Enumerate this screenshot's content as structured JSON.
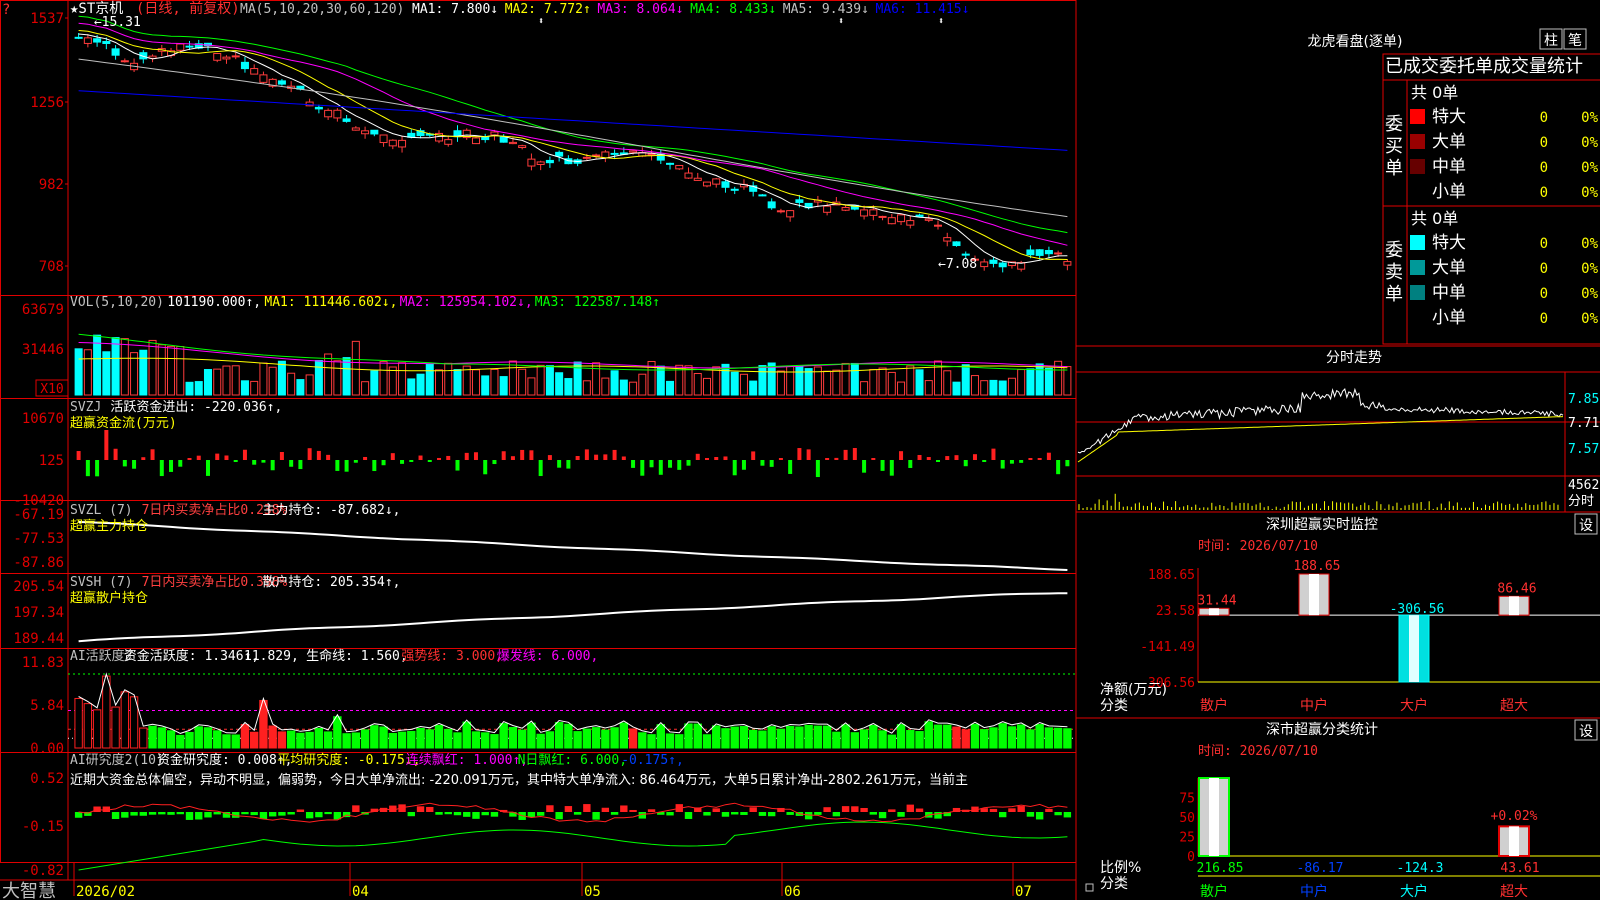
{
  "title_bar": {
    "stock_name": "★ST京机",
    "period": "(日线, 前复权)",
    "ma_label": "MA(5,10,20,30,60,120)",
    "ma_values": [
      {
        "label": "MA1: 7.800↓",
        "color": "#ffffff"
      },
      {
        "label": "MA2: 7.772↑",
        "color": "#ffff00"
      },
      {
        "label": "MA3: 8.064↓",
        "color": "#ff00ff"
      },
      {
        "label": "MA4: 8.433↓",
        "color": "#00ff00"
      },
      {
        "label": "MA5: 9.439↓",
        "color": "#c0c0c0"
      },
      {
        "label": "MA6: 11.415↓",
        "color": "#0000ff"
      }
    ]
  },
  "main_panel": {
    "y_ticks": [
      "1537",
      "1256",
      "982",
      "708"
    ],
    "high_label": "15.31",
    "low_label": "7.08"
  },
  "vol_panel": {
    "header": [
      {
        "text": "VOL(5,10,20)",
        "color": "#c0c0c0"
      },
      {
        "text": "101190.000↑,",
        "color": "#ffffff"
      },
      {
        "text": "MA1: 111446.602↓,",
        "color": "#ffff00"
      },
      {
        "text": "MA2: 125954.102↓,",
        "color": "#ff00ff"
      },
      {
        "text": "MA3: 122587.148↑",
        "color": "#00ff00"
      }
    ],
    "y_ticks": [
      "63679",
      "31446"
    ],
    "unit": "X10"
  },
  "svzj_panel": {
    "header": [
      {
        "text": "SVZJ",
        "color": "#c0c0c0"
      },
      {
        "text": "活跃资金进出: -220.036↑,",
        "color": "#ffffff"
      }
    ],
    "subtitle": "超赢资金流(万元)",
    "y_ticks": [
      "10670",
      "125",
      "-10420"
    ]
  },
  "svzl_panel": {
    "header": [
      {
        "text": "SVZL (7)",
        "color": "#c0c0c0"
      },
      {
        "text": "7日内买卖净占比0.238%",
        "color": "#ff4040"
      },
      {
        "text": "主力持仓: -87.682↓,",
        "color": "#ffffff"
      }
    ],
    "subtitle": "超赢主力持仓",
    "y_ticks": [
      "-67.19",
      "-77.53",
      "-87.86"
    ]
  },
  "svsh_panel": {
    "header": [
      {
        "text": "SVSH (7)",
        "color": "#c0c0c0"
      },
      {
        "text": "7日内买卖净占比0.398%",
        "color": "#ff4040"
      },
      {
        "text": "散户持仓: 205.354↑,",
        "color": "#ffffff"
      }
    ],
    "subtitle": "超赢散户持仓",
    "y_ticks": [
      "205.54",
      "197.34",
      "189.44"
    ]
  },
  "ai_active_panel": {
    "header": [
      {
        "text": "AI活跃度2",
        "color": "#c0c0c0"
      },
      {
        "text": "资金活跃度: 1.346↑,",
        "color": "#ffffff"
      },
      {
        "text": "11.829,",
        "color": "#ffffff"
      },
      {
        "text": "生命线: 1.560,",
        "color": "#ffffff"
      },
      {
        "text": "强势线: 3.000,",
        "color": "#ff3030"
      },
      {
        "text": "爆发线: 6.000,",
        "color": "#ff00ff"
      }
    ],
    "y_ticks": [
      "11.83",
      "5.84",
      "0.00"
    ]
  },
  "ai_research_panel": {
    "header": [
      {
        "text": "AI研究度2(10)",
        "color": "#c0c0c0"
      },
      {
        "text": "资金研究度: 0.008↑,",
        "color": "#ffffff"
      },
      {
        "text": "平均研究度: -0.175↓,",
        "color": "#ffff00"
      },
      {
        "text": "连续飘红: 1.000↑,",
        "color": "#ff00ff"
      },
      {
        "text": "N日飘红: 6.000,",
        "color": "#00ff00"
      },
      {
        "text": "-0.175↑,",
        "color": "#0040ff"
      }
    ],
    "commentary": "近期大资金总体偏空，异动不明显，偏弱势，今日大单净流出: -220.091万元，其中特大单净流入: 86.464万元，大单5日累计净出-2802.261万元，当前主",
    "y_ticks": [
      "0.52",
      "-0.15",
      "-0.82"
    ]
  },
  "x_axis": {
    "labels": [
      "2026/02",
      "04",
      "05",
      "06",
      "07"
    ],
    "brand": "大智慧"
  },
  "right_panel": {
    "dragon_title": "龙虎看盘(逐单)",
    "btn_bar": "柱",
    "btn_pen": "笔",
    "table_header": "已成交委托单成交量统计",
    "buy": {
      "side_label": "委买单",
      "total": "共 0单",
      "rows": [
        {
          "label": "特大",
          "count": "0",
          "pct": "0%",
          "color": "#ff0000"
        },
        {
          "label": "大单",
          "count": "0",
          "pct": "0%",
          "color": "#990000"
        },
        {
          "label": "中单",
          "count": "0",
          "pct": "0%",
          "color": "#660000"
        },
        {
          "label": "小单",
          "count": "0",
          "pct": "0%",
          "color": ""
        }
      ]
    },
    "sell": {
      "side_label": "委卖单",
      "total": "共 0单",
      "rows": [
        {
          "label": "特大",
          "count": "0",
          "pct": "0%",
          "color": "#00ffff"
        },
        {
          "label": "大单",
          "count": "0",
          "pct": "0%",
          "color": "#009999"
        },
        {
          "label": "中单",
          "count": "0",
          "pct": "0%",
          "color": "#008080"
        },
        {
          "label": "小单",
          "count": "0",
          "pct": "0%",
          "color": ""
        }
      ]
    },
    "intraday": {
      "title": "分时走势",
      "y_ticks": [
        "7.85",
        "7.71",
        "7.57"
      ],
      "vol_label": "4562",
      "vol_unit": "分时"
    },
    "monitor": {
      "title": "深圳超赢实时监控",
      "btn": "设",
      "time": "时间: 2026/07/10",
      "y_ticks": [
        "188.65",
        "23.58",
        "-141.49",
        "-306.56"
      ],
      "ylabel": "净额(万元)",
      "xlabel": "分类"
    },
    "classify": {
      "title": "深市超赢分类统计",
      "btn": "设",
      "time": "时间: 2026/07/10",
      "y_ticks": [
        "75",
        "50",
        "25",
        "0"
      ],
      "ylabel": "比例%",
      "xlabel": "分类",
      "bar_label": "+0.02%"
    }
  },
  "chart_data": [
    {
      "type": "candlestick",
      "name": "main",
      "ylim": [
        7.0,
        15.6
      ],
      "count": 108,
      "ma": [
        {
          "name": "MA1",
          "color": "#ffffff",
          "last": 7.8
        },
        {
          "name": "MA2",
          "color": "#ffff00",
          "last": 7.772
        },
        {
          "name": "MA3",
          "color": "#ff00ff",
          "last": 8.064
        },
        {
          "name": "MA4",
          "color": "#00ff00",
          "last": 8.433
        },
        {
          "name": "MA5",
          "color": "#c0c0c0",
          "last": 9.439
        },
        {
          "name": "MA6",
          "color": "#0000ff",
          "last": 11.415
        }
      ],
      "close_path": [
        [
          0,
          15.1
        ],
        [
          6,
          14.2
        ],
        [
          10,
          14.6
        ],
        [
          14,
          14.8
        ],
        [
          19,
          13.9
        ],
        [
          24,
          13.2
        ],
        [
          30,
          12.2
        ],
        [
          36,
          11.7
        ],
        [
          42,
          12.0
        ],
        [
          46,
          11.8
        ],
        [
          50,
          11.0
        ],
        [
          56,
          11.2
        ],
        [
          62,
          11.4
        ],
        [
          67,
          10.6
        ],
        [
          72,
          10.2
        ],
        [
          76,
          9.6
        ],
        [
          80,
          9.8
        ],
        [
          84,
          9.5
        ],
        [
          88,
          9.4
        ],
        [
          92,
          9.2
        ],
        [
          97,
          8.0
        ],
        [
          100,
          7.6
        ],
        [
          103,
          8.2
        ],
        [
          107,
          8.0
        ]
      ],
      "high": 15.31,
      "low": 7.08
    },
    {
      "type": "bar",
      "name": "volume",
      "ylim": [
        0,
        63679
      ],
      "ma_lines": [
        {
          "name": "MA1",
          "value": 111446.602,
          "color": "#ffff00"
        },
        {
          "name": "MA2",
          "value": 125954.102,
          "color": "#ff00ff"
        },
        {
          "name": "MA3",
          "value": 122587.148,
          "color": "#00ff00"
        }
      ],
      "last": 101190.0
    },
    {
      "type": "bar",
      "name": "svzj_fund_flow",
      "ylim": [
        -10420,
        10670
      ],
      "last": -220.036
    },
    {
      "type": "line",
      "name": "svzl_main_holding",
      "ylim": [
        -87.86,
        -67.19
      ],
      "start": -68.0,
      "end": -87.682
    },
    {
      "type": "line",
      "name": "svsh_retail_holding",
      "ylim": [
        189.44,
        205.54
      ],
      "start": 190.0,
      "end": 205.354
    },
    {
      "type": "bar",
      "name": "ai_activity",
      "ylim": [
        0,
        11.83
      ],
      "thresholds": [
        {
          "name": "生命线",
          "value": 1.56
        },
        {
          "name": "强势线",
          "value": 3.0
        },
        {
          "name": "爆发线",
          "value": 6.0
        }
      ],
      "last": 1.346
    },
    {
      "type": "bar",
      "name": "ai_research",
      "ylim": [
        -0.82,
        0.52
      ],
      "last": 0.008
    },
    {
      "type": "line",
      "name": "intraday",
      "ylim": [
        7.5,
        7.92
      ],
      "ticks": [
        7.85,
        7.71,
        7.57
      ]
    },
    {
      "type": "bar",
      "name": "sz_realtime_monitor",
      "categories": [
        "散户",
        "中户",
        "大户",
        "超大"
      ],
      "values": [
        31.44,
        188.65,
        -306.56,
        86.46
      ],
      "ylim": [
        -306.56,
        188.65
      ]
    },
    {
      "type": "bar",
      "name": "sz_classification",
      "categories": [
        "散户",
        "中户",
        "大户",
        "超大"
      ],
      "values": [
        216.85,
        -86.17,
        -124.3,
        43.61
      ],
      "ratios": [
        100,
        0,
        0,
        38
      ],
      "ylim": [
        0,
        100
      ]
    }
  ]
}
